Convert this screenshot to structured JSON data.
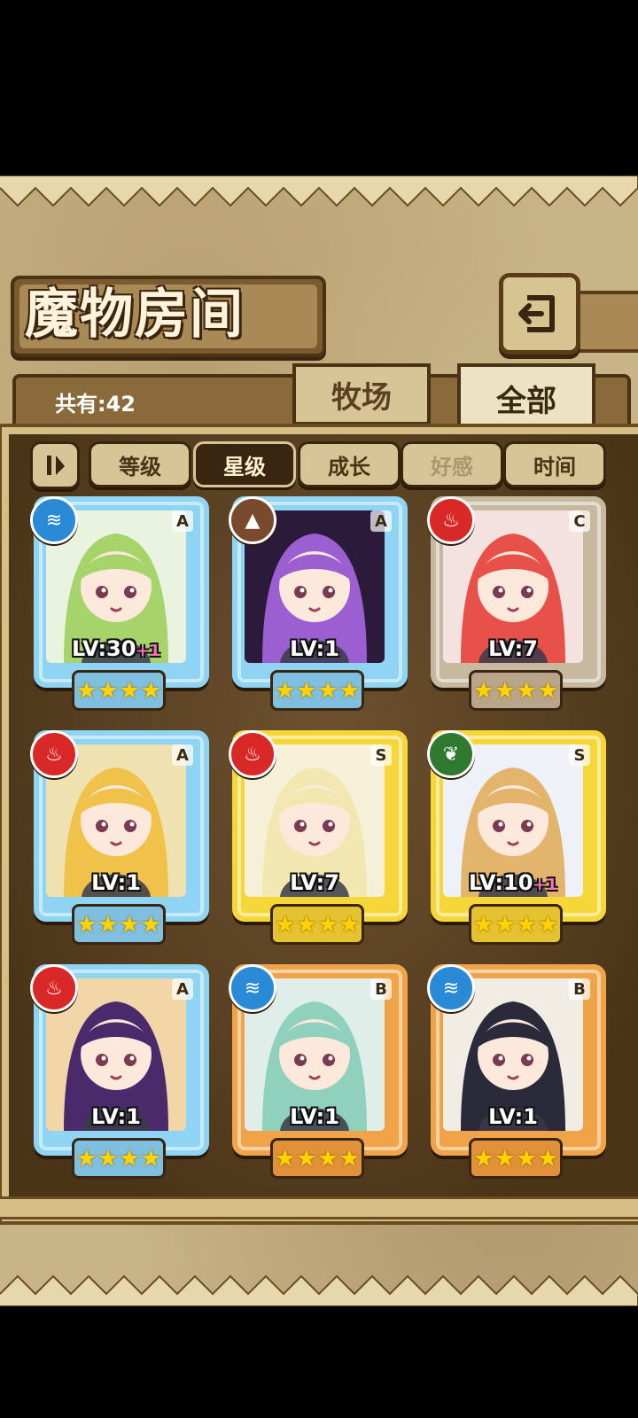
{
  "header": {
    "title": "魔物房间",
    "total_label": "共有:42",
    "back_icon": "back-arrow-icon"
  },
  "tabs": [
    {
      "label": "牧场",
      "active": false
    },
    {
      "label": "全部",
      "active": true
    }
  ],
  "sort": {
    "toggle_icon": "order-toggle-icon",
    "buttons": [
      {
        "label": "等级",
        "active": false,
        "dim": false
      },
      {
        "label": "星级",
        "active": true,
        "dim": false
      },
      {
        "label": "成长",
        "active": false,
        "dim": false
      },
      {
        "label": "好感",
        "active": false,
        "dim": true
      },
      {
        "label": "时间",
        "active": false,
        "dim": false
      }
    ]
  },
  "cards": [
    {
      "rank": "A",
      "element": "water",
      "element_color": "#2a8ad6",
      "frame_color": "#8fd4f2",
      "level": "LV:30",
      "bonus": "+1",
      "stars": "★★★★",
      "stars_bg": "#7fbfe0",
      "portrait_bg": "#e9f3e0",
      "hair": "#a6d36a"
    },
    {
      "rank": "A",
      "element": "earth",
      "element_color": "#7a4a2e",
      "frame_color": "#8fd4f2",
      "level": "LV:1",
      "bonus": "",
      "stars": "★★★★",
      "stars_bg": "#7fbfe0",
      "portrait_bg": "#2b1a3a",
      "hair": "#9b5fd1"
    },
    {
      "rank": "C",
      "element": "fire",
      "element_color": "#d82828",
      "frame_color": "#c7b8a0",
      "level": "LV:7",
      "bonus": "",
      "stars": "★★★★",
      "stars_bg": "#b8a58a",
      "portrait_bg": "#f3e2e0",
      "hair": "#e8504a"
    },
    {
      "rank": "A",
      "element": "fire",
      "element_color": "#d82828",
      "frame_color": "#8fd4f2",
      "level": "LV:1",
      "bonus": "",
      "stars": "★★★★",
      "stars_bg": "#7fbfe0",
      "portrait_bg": "#f0e2b0",
      "hair": "#f0c24a"
    },
    {
      "rank": "S",
      "element": "fire",
      "element_color": "#d82828",
      "frame_color": "#f5d73a",
      "level": "LV:7",
      "bonus": "",
      "stars": "★★★★",
      "stars_bg": "#e5c230",
      "portrait_bg": "#f6f0d8",
      "hair": "#f2e7b0"
    },
    {
      "rank": "S",
      "element": "wind",
      "element_color": "#2f7a2f",
      "frame_color": "#f5d73a",
      "level": "LV:10",
      "bonus": "+1",
      "stars": "★★★★",
      "stars_bg": "#e5c230",
      "portrait_bg": "#eef1f7",
      "hair": "#e3b46c"
    },
    {
      "rank": "A",
      "element": "fire",
      "element_color": "#d82828",
      "frame_color": "#8fd4f2",
      "level": "LV:1",
      "bonus": "",
      "stars": "★★★★",
      "stars_bg": "#7fbfe0",
      "portrait_bg": "#f3d6a8",
      "hair": "#4a2a6a"
    },
    {
      "rank": "B",
      "element": "water",
      "element_color": "#2a8ad6",
      "frame_color": "#f0a348",
      "level": "LV:1",
      "bonus": "",
      "stars": "★★★★",
      "stars_bg": "#e0913a",
      "portrait_bg": "#dfeee8",
      "hair": "#8fd1bd"
    },
    {
      "rank": "B",
      "element": "water",
      "element_color": "#2a8ad6",
      "frame_color": "#f0a348",
      "level": "LV:1",
      "bonus": "",
      "stars": "★★★★",
      "stars_bg": "#e0913a",
      "portrait_bg": "#f1ece4",
      "hair": "#2a2a3a"
    }
  ]
}
